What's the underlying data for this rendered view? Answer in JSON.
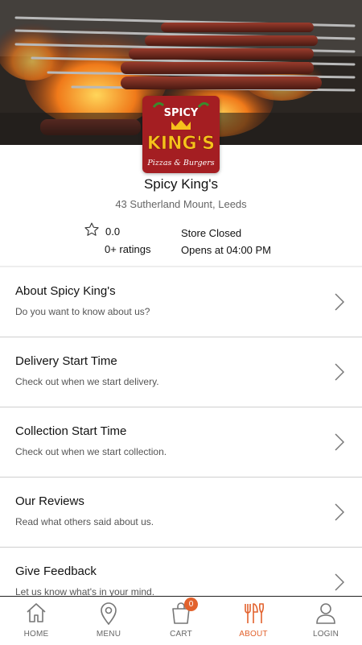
{
  "store": {
    "name": "Spicy King's",
    "address": "43 Sutherland Mount, Leeds",
    "rating": "0.0",
    "ratings_count": "0+ ratings",
    "status": "Store Closed",
    "opens_at": "Opens at 04:00 PM",
    "logo": {
      "line1": "SPICY",
      "line2": "KING'S",
      "line3": "Pizzas & Burgers"
    }
  },
  "menu_items": [
    {
      "title": "About Spicy King's",
      "subtitle": "Do you want to know about us?"
    },
    {
      "title": "Delivery Start Time",
      "subtitle": "Check out when we start delivery."
    },
    {
      "title": "Collection Start Time",
      "subtitle": "Check out when we start collection."
    },
    {
      "title": "Our Reviews",
      "subtitle": "Read what others said about us."
    },
    {
      "title": "Give Feedback",
      "subtitle": "Let us know what's in your mind."
    }
  ],
  "nav": {
    "home": "HOME",
    "menu": "MENU",
    "cart": "CART",
    "cart_count": "0",
    "about": "ABOUT",
    "login": "LOGIN"
  },
  "colors": {
    "accent": "#e2622d",
    "logo_bg": "#a41e22",
    "logo_text": "#f6c21b"
  }
}
